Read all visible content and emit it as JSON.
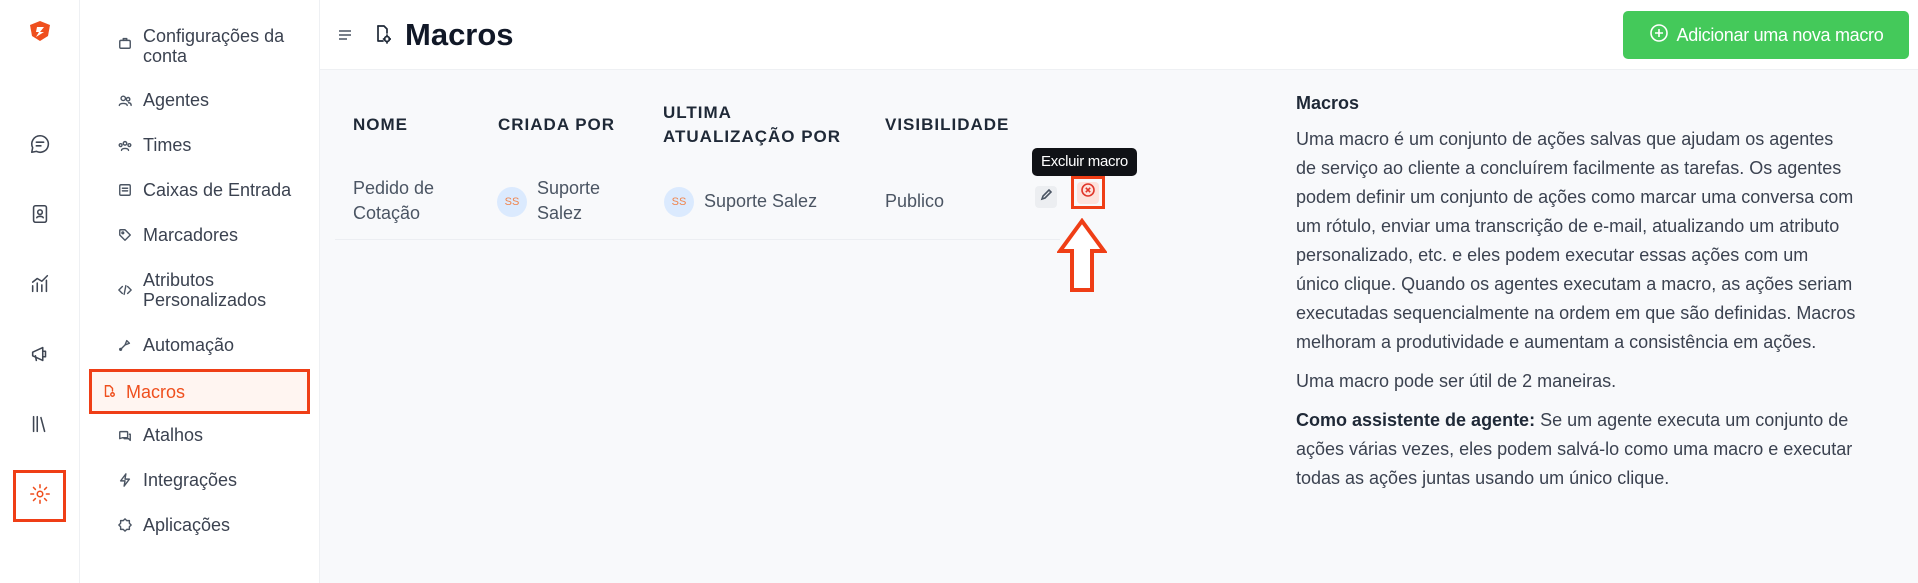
{
  "colors": {
    "accent": "#ef4f1e",
    "highlight": "#ef3e16",
    "add_button": "#44c95a"
  },
  "rail": {
    "items": [
      {
        "name": "conversations",
        "icon": "chat-bubble-icon"
      },
      {
        "name": "contacts",
        "icon": "contact-book-icon"
      },
      {
        "name": "reports",
        "icon": "chart-line-icon"
      },
      {
        "name": "campaigns",
        "icon": "megaphone-icon"
      },
      {
        "name": "library",
        "icon": "library-icon"
      },
      {
        "name": "settings",
        "icon": "gear-icon",
        "active": true
      }
    ]
  },
  "sidebar": {
    "items": [
      {
        "label": "Configurações da conta",
        "icon": "briefcase-icon"
      },
      {
        "label": "Agentes",
        "icon": "users-icon"
      },
      {
        "label": "Times",
        "icon": "team-icon"
      },
      {
        "label": "Caixas de Entrada",
        "icon": "inbox-icon"
      },
      {
        "label": "Marcadores",
        "icon": "tag-icon"
      },
      {
        "label": "Atributos Personalizados",
        "icon": "code-icon"
      },
      {
        "label": "Automação",
        "icon": "automation-icon"
      },
      {
        "label": "Macros",
        "icon": "macro-icon",
        "active": true
      },
      {
        "label": "Atalhos",
        "icon": "chat-shortcut-icon"
      },
      {
        "label": "Integrações",
        "icon": "lightning-icon"
      },
      {
        "label": "Aplicações",
        "icon": "apps-icon"
      }
    ]
  },
  "header": {
    "title": "Macros",
    "add_button_label": "Adicionar uma nova macro"
  },
  "table": {
    "headers": [
      "NOME",
      "CRIADA POR",
      "ULTIMA ATUALIZAÇÃO POR",
      "VISIBILIDADE"
    ],
    "header_lines": {
      "updated_line1": "ULTIMA",
      "updated_line2": "ATUALIZAÇÃO POR"
    },
    "rows": [
      {
        "name_line1": "Pedido de",
        "name_line2": "Cotação",
        "created_by_initials": "SS",
        "created_by_line1": "Suporte",
        "created_by_line2": "Salez",
        "updated_by_initials": "SS",
        "updated_by": "Suporte Salez",
        "visibility": "Publico"
      }
    ],
    "delete_tooltip": "Excluir macro"
  },
  "help": {
    "title": "Macros",
    "p1": "Uma macro é um conjunto de ações salvas que ajudam os agentes de serviço ao cliente a concluírem facilmente as tarefas. Os agentes podem definir um conjunto de ações como marcar uma conversa com um rótulo, enviar uma transcrição de e-mail, atualizando um atributo personalizado, etc. e eles podem executar essas ações com um único clique. Quando os agentes executam a macro, as ações seriam executadas sequencialmente na ordem em que são definidas. Macros melhoram a produtividade e aumentam a consistência em ações.",
    "p2": "Uma macro pode ser útil de 2 maneiras.",
    "p3_bold": "Como assistente de agente:",
    "p3_rest": " Se um agente executa um conjunto de ações várias vezes, eles podem salvá-lo como uma macro e executar todas as ações juntas usando um único clique."
  }
}
